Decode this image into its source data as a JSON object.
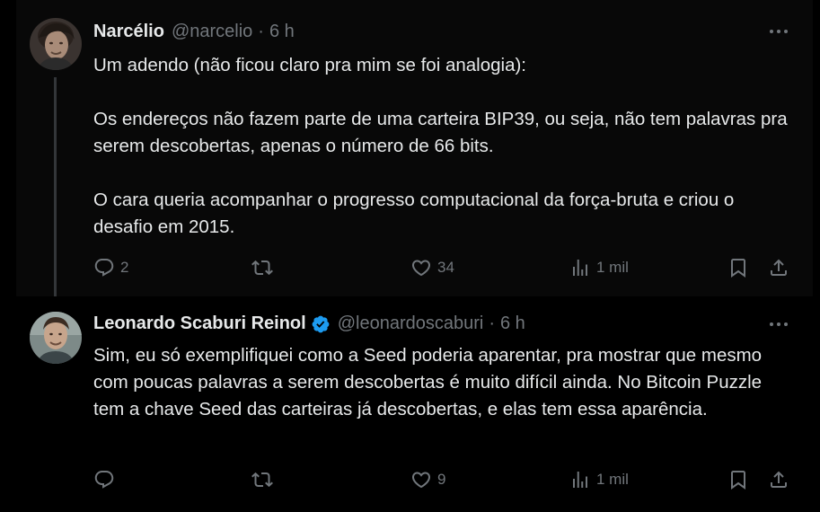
{
  "colors": {
    "background": "#000000",
    "text": "#e7e9ea",
    "muted": "#71767b",
    "verified": "#1d9bf0",
    "thread_line": "#333639"
  },
  "tweets": [
    {
      "author": {
        "name": "Narcélio",
        "handle": "@narcelio",
        "verified": false
      },
      "separator": "·",
      "time": "6 h",
      "paragraphs": [
        "Um adendo (não ficou claro pra mim se foi analogia):",
        "Os endereços não fazem parte de uma carteira BIP39, ou seja, não tem palavras pra serem descobertas, apenas o número de 66 bits.",
        "O cara queria acompanhar o progresso computacional da força-bruta e criou o desafio em 2015."
      ],
      "actions": {
        "replies": "2",
        "retweets": "",
        "likes": "34",
        "views": "1 mil"
      }
    },
    {
      "author": {
        "name": "Leonardo Scaburi Reinol",
        "handle": "@leonardoscaburi",
        "verified": true
      },
      "separator": "·",
      "time": "6 h",
      "paragraphs": [
        "Sim, eu só exemplifiquei como a Seed poderia aparentar, pra mostrar que mesmo com poucas palavras a serem descobertas é muito difícil ainda. No Bitcoin Puzzle tem a chave Seed das carteiras já descobertas, e elas tem essa aparência."
      ],
      "actions": {
        "replies": "",
        "retweets": "",
        "likes": "9",
        "views": "1 mil"
      }
    }
  ],
  "icons": {
    "reply": "reply-icon",
    "retweet": "retweet-icon",
    "like": "heart-icon",
    "views": "views-icon",
    "bookmark": "bookmark-icon",
    "share": "share-icon",
    "more": "more-icon",
    "verified": "verified-badge-icon"
  }
}
